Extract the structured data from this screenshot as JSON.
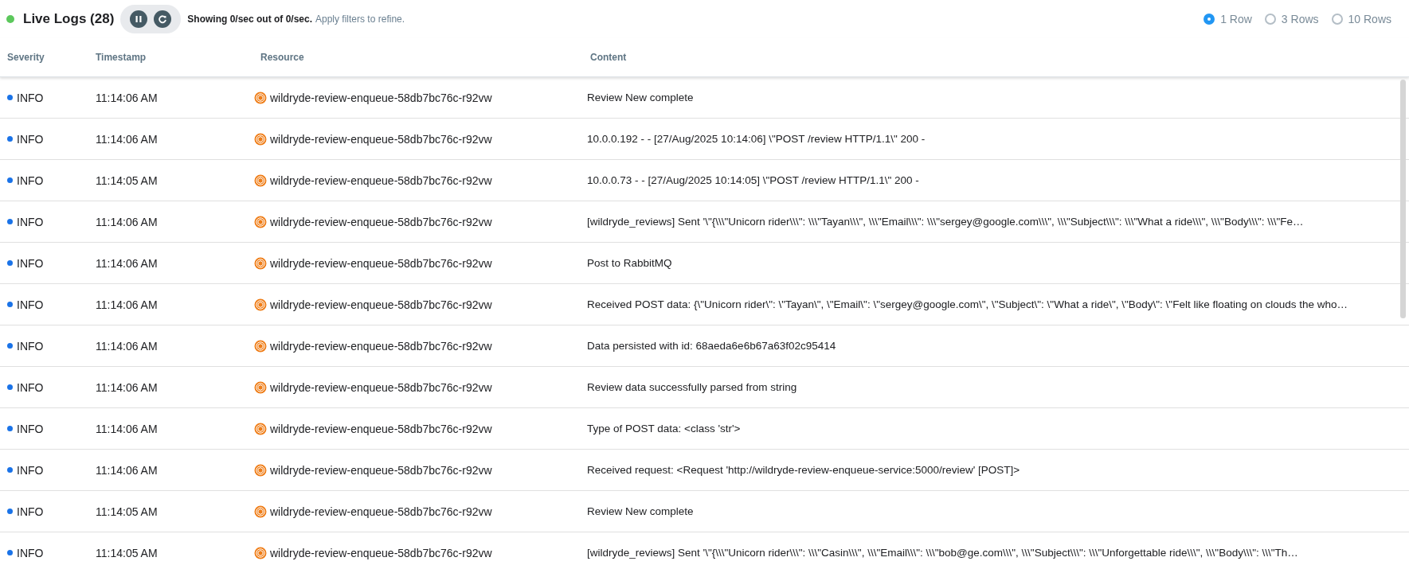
{
  "header": {
    "title": "Live Logs (28)",
    "live": true,
    "rate_text": "Showing 0/sec out of 0/sec.",
    "hint": "Apply filters to refine.",
    "row_options": [
      {
        "label": "1 Row",
        "selected": true
      },
      {
        "label": "3 Rows",
        "selected": false
      },
      {
        "label": "10 Rows",
        "selected": false
      }
    ]
  },
  "table": {
    "columns": [
      "Severity",
      "Timestamp",
      "Resource",
      "Content"
    ],
    "rows": [
      {
        "severity": "INFO",
        "color": "#1a73e8",
        "timestamp": "11:14:06 AM",
        "resource": "wildryde-review-enqueue-58db7bc76c-r92vw",
        "content": "Review New complete"
      },
      {
        "severity": "INFO",
        "color": "#1a73e8",
        "timestamp": "11:14:06 AM",
        "resource": "wildryde-review-enqueue-58db7bc76c-r92vw",
        "content": "10.0.0.192 - - [27/Aug/2025 10:14:06] \\\"POST /review HTTP/1.1\\\" 200 -"
      },
      {
        "severity": "INFO",
        "color": "#1a73e8",
        "timestamp": "11:14:05 AM",
        "resource": "wildryde-review-enqueue-58db7bc76c-r92vw",
        "content": "10.0.0.73 - - [27/Aug/2025 10:14:05] \\\"POST /review HTTP/1.1\\\" 200 -"
      },
      {
        "severity": "INFO",
        "color": "#1a73e8",
        "timestamp": "11:14:06 AM",
        "resource": "wildryde-review-enqueue-58db7bc76c-r92vw",
        "content": "[wildryde_reviews] Sent '\\\"{\\\\\\\"Unicorn rider\\\\\\\": \\\\\\\"Tayan\\\\\\\", \\\\\\\"Email\\\\\\\": \\\\\\\"sergey@google.com\\\\\\\", \\\\\\\"Subject\\\\\\\": \\\\\\\"What a ride\\\\\\\", \\\\\\\"Body\\\\\\\": \\\\\\\"Fe…"
      },
      {
        "severity": "INFO",
        "color": "#1a73e8",
        "timestamp": "11:14:06 AM",
        "resource": "wildryde-review-enqueue-58db7bc76c-r92vw",
        "content": "Post to RabbitMQ"
      },
      {
        "severity": "INFO",
        "color": "#1a73e8",
        "timestamp": "11:14:06 AM",
        "resource": "wildryde-review-enqueue-58db7bc76c-r92vw",
        "content": "Received POST data: {\\\"Unicorn rider\\\": \\\"Tayan\\\", \\\"Email\\\": \\\"sergey@google.com\\\", \\\"Subject\\\": \\\"What a ride\\\", \\\"Body\\\": \\\"Felt like floating on clouds the who…"
      },
      {
        "severity": "INFO",
        "color": "#1a73e8",
        "timestamp": "11:14:06 AM",
        "resource": "wildryde-review-enqueue-58db7bc76c-r92vw",
        "content": "Data persisted with id: 68aeda6e6b67a63f02c95414"
      },
      {
        "severity": "INFO",
        "color": "#1a73e8",
        "timestamp": "11:14:06 AM",
        "resource": "wildryde-review-enqueue-58db7bc76c-r92vw",
        "content": "Review data successfully parsed from string"
      },
      {
        "severity": "INFO",
        "color": "#1a73e8",
        "timestamp": "11:14:06 AM",
        "resource": "wildryde-review-enqueue-58db7bc76c-r92vw",
        "content": "Type of POST data: <class 'str'>"
      },
      {
        "severity": "INFO",
        "color": "#1a73e8",
        "timestamp": "11:14:06 AM",
        "resource": "wildryde-review-enqueue-58db7bc76c-r92vw",
        "content": "Received request: <Request 'http://wildryde-review-enqueue-service:5000/review' [POST]>"
      },
      {
        "severity": "INFO",
        "color": "#1a73e8",
        "timestamp": "11:14:05 AM",
        "resource": "wildryde-review-enqueue-58db7bc76c-r92vw",
        "content": "Review New complete"
      },
      {
        "severity": "INFO",
        "color": "#1a73e8",
        "timestamp": "11:14:05 AM",
        "resource": "wildryde-review-enqueue-58db7bc76c-r92vw",
        "content": "[wildryde_reviews] Sent '\\\"{\\\\\\\"Unicorn rider\\\\\\\": \\\\\\\"Casin\\\\\\\", \\\\\\\"Email\\\\\\\": \\\\\\\"bob@ge.com\\\\\\\", \\\\\\\"Subject\\\\\\\": \\\\\\\"Unforgettable ride\\\\\\\", \\\\\\\"Body\\\\\\\": \\\\\\\"Th…"
      }
    ]
  }
}
